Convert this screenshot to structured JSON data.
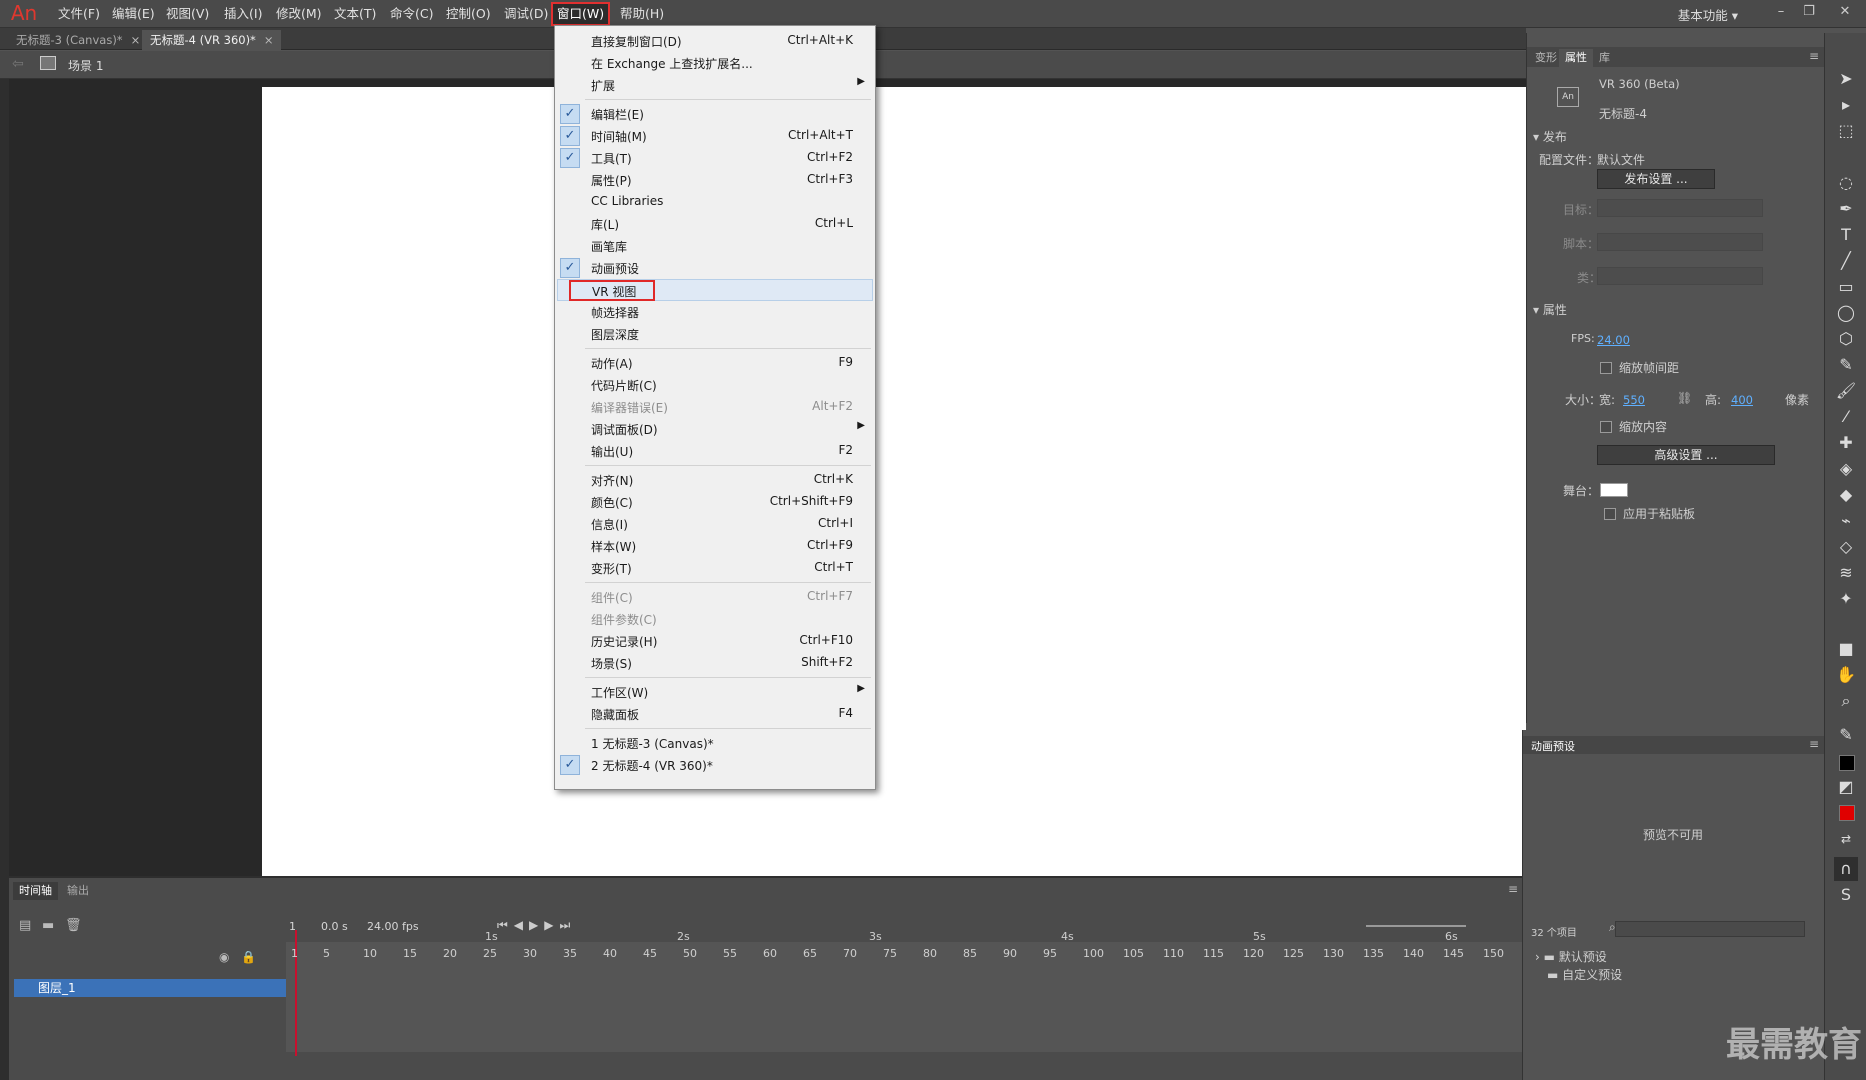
{
  "app": {
    "logo": "An"
  },
  "menubar": {
    "items": [
      "文件(F)",
      "编辑(E)",
      "视图(V)",
      "插入(I)",
      "修改(M)",
      "文本(T)",
      "命令(C)",
      "控制(O)",
      "调试(D)",
      "窗口(W)",
      "帮助(H)"
    ],
    "active": "窗口(W)",
    "workspace": "基本功能 ▾"
  },
  "tabs": [
    {
      "label": "无标题-3 (Canvas)*",
      "active": false
    },
    {
      "label": "无标题-4 (VR 360)*",
      "active": true
    }
  ],
  "scene": {
    "label": "场景 1"
  },
  "menu": {
    "items": [
      {
        "label": "直接复制窗口(D)",
        "shortcut": "Ctrl+Alt+K"
      },
      {
        "label": "在 Exchange 上查找扩展名..."
      },
      {
        "label": "扩展",
        "submenu": true
      },
      {
        "label": "编辑栏(E)",
        "checked": true
      },
      {
        "label": "时间轴(M)",
        "shortcut": "Ctrl+Alt+T",
        "checked": true
      },
      {
        "label": "工具(T)",
        "shortcut": "Ctrl+F2",
        "checked": true
      },
      {
        "label": "属性(P)",
        "shortcut": "Ctrl+F3"
      },
      {
        "label": "CC Libraries"
      },
      {
        "label": "库(L)",
        "shortcut": "Ctrl+L"
      },
      {
        "label": "画笔库"
      },
      {
        "label": "动画预设",
        "checked": true
      },
      {
        "label": "VR 视图",
        "highlight": true
      },
      {
        "label": "帧选择器"
      },
      {
        "label": "图层深度"
      },
      {
        "label": "动作(A)",
        "shortcut": "F9"
      },
      {
        "label": "代码片断(C)"
      },
      {
        "label": "编译器错误(E)",
        "shortcut": "Alt+F2",
        "disabled": true
      },
      {
        "label": "调试面板(D)",
        "submenu": true
      },
      {
        "label": "输出(U)",
        "shortcut": "F2"
      },
      {
        "label": "对齐(N)",
        "shortcut": "Ctrl+K"
      },
      {
        "label": "颜色(C)",
        "shortcut": "Ctrl+Shift+F9"
      },
      {
        "label": "信息(I)",
        "shortcut": "Ctrl+I"
      },
      {
        "label": "样本(W)",
        "shortcut": "Ctrl+F9"
      },
      {
        "label": "变形(T)",
        "shortcut": "Ctrl+T"
      },
      {
        "label": "组件(C)",
        "shortcut": "Ctrl+F7",
        "disabled": true
      },
      {
        "label": "组件参数(C)",
        "disabled": true
      },
      {
        "label": "历史记录(H)",
        "shortcut": "Ctrl+F10"
      },
      {
        "label": "场景(S)",
        "shortcut": "Shift+F2"
      },
      {
        "label": "工作区(W)",
        "submenu": true
      },
      {
        "label": "隐藏面板",
        "shortcut": "F4"
      },
      {
        "label": "1 无标题-3 (Canvas)*"
      },
      {
        "label": "2 无标题-4 (VR 360)*",
        "checked": true
      }
    ]
  },
  "properties": {
    "tabs": [
      "变形",
      "属性",
      "库"
    ],
    "active_tab": "属性",
    "doc_type": "VR 360 (Beta)",
    "doc_name": "无标题-4",
    "publish_section": "发布",
    "profile_label": "配置文件：",
    "profile_value": "默认文件",
    "publish_settings": "发布设置 ...",
    "target_label": "目标：",
    "script_label": "脚本：",
    "class_label": "类：",
    "props_section": "属性",
    "fps_label": "FPS:",
    "fps_value": "24.00",
    "scale_span_label": "缩放帧间距",
    "size_label": "大小：",
    "width_label": "宽:",
    "width_value": "550",
    "height_label": "高:",
    "height_value": "400",
    "unit": "像素",
    "scale_content": "缩放内容",
    "advanced": "高级设置 ...",
    "stage_label": "舞台：",
    "stage_color": "#ffffff",
    "apply_paste": "应用于粘贴板"
  },
  "presets": {
    "title": "动画预设",
    "preview": "预览不可用",
    "count": "32 个项目",
    "folders": [
      "默认预设",
      "自定义预设"
    ]
  },
  "timeline": {
    "tabs": [
      "时间轴",
      "输出"
    ],
    "frame": "1",
    "time": "0.0 s",
    "fps": "24.00 fps",
    "layer": "图层_1",
    "seconds": [
      "1s",
      "2s",
      "3s",
      "4s",
      "5s",
      "6s"
    ],
    "frames": [
      "1",
      "5",
      "10",
      "15",
      "20",
      "25",
      "30",
      "35",
      "40",
      "45",
      "50",
      "55",
      "60",
      "65",
      "70",
      "75",
      "80",
      "85",
      "90",
      "95",
      "100",
      "105",
      "110",
      "115",
      "120",
      "125",
      "130",
      "135",
      "140",
      "145",
      "150"
    ]
  },
  "watermark": "最需教育",
  "colors": {
    "accent_red": "#e03030",
    "selection": "#3b72b8",
    "link": "#5fb0ff"
  }
}
